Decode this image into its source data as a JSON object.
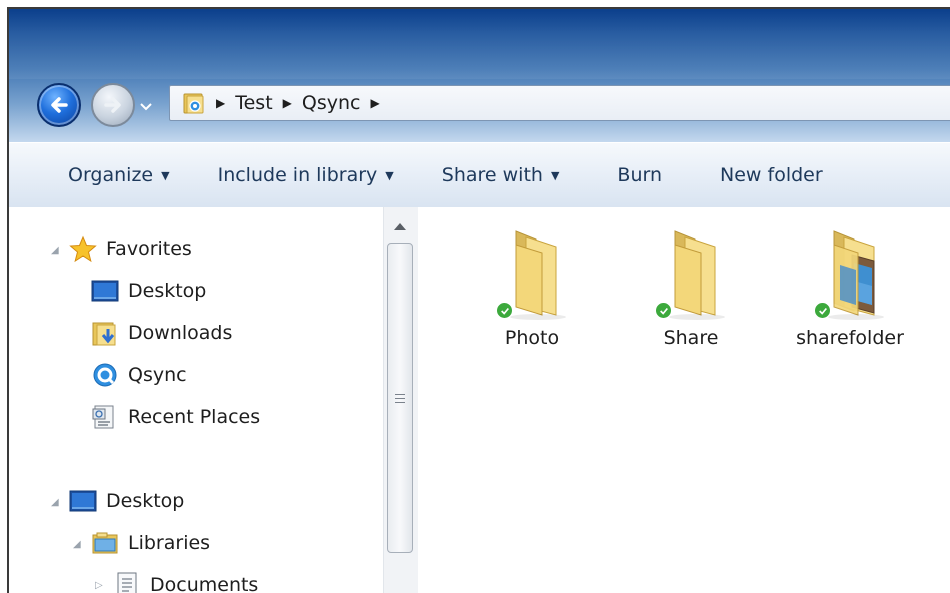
{
  "address": {
    "crumbs": [
      "Test",
      "Qsync"
    ]
  },
  "toolbar": {
    "organize": "Organize",
    "include_in_library": "Include in library",
    "share_with": "Share with",
    "burn": "Burn",
    "new_folder": "New folder"
  },
  "nav": {
    "favorites": "Favorites",
    "desktop_fav": "Desktop",
    "downloads": "Downloads",
    "qsync": "Qsync",
    "recent_places": "Recent Places",
    "desktop_root": "Desktop",
    "libraries": "Libraries",
    "documents": "Documents"
  },
  "files": [
    {
      "name": "Photo",
      "synced": true
    },
    {
      "name": "Share",
      "synced": true
    },
    {
      "name": "sharefolder",
      "synced": true
    }
  ],
  "colors": {
    "accent": "#1e395b",
    "sync_ok": "#3ca93c",
    "folder": "#f3d77a"
  }
}
